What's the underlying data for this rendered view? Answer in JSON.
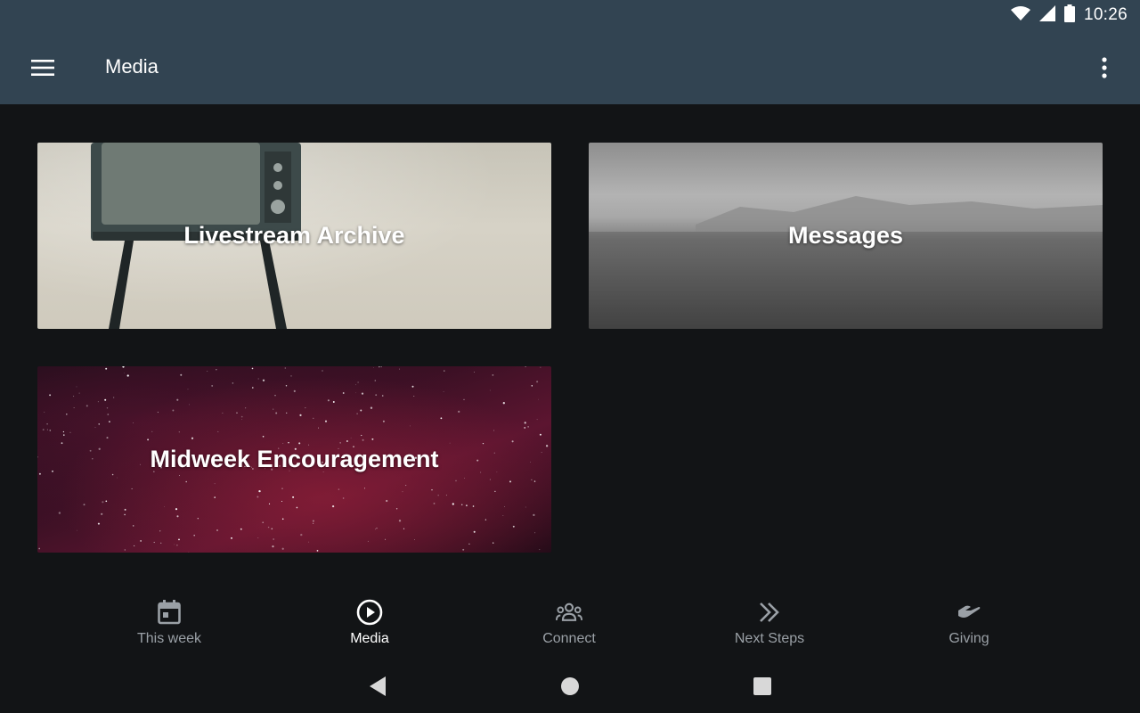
{
  "status_bar": {
    "time": "10:26",
    "icons": [
      "wifi-icon",
      "signal-icon",
      "battery-icon"
    ]
  },
  "app_bar": {
    "title": "Media",
    "menu_icon": "hamburger-menu-icon",
    "overflow_icon": "more-vert-icon"
  },
  "cards": [
    {
      "id": "livestream",
      "label": "Livestream Archive"
    },
    {
      "id": "messages",
      "label": "Messages"
    },
    {
      "id": "midweek",
      "label": "Midweek Encouragement"
    }
  ],
  "bottom_nav": {
    "active": "Media",
    "items": [
      {
        "label": "This week",
        "icon": "calendar-icon"
      },
      {
        "label": "Media",
        "icon": "play-circle-icon"
      },
      {
        "label": "Connect",
        "icon": "group-icon"
      },
      {
        "label": "Next Steps",
        "icon": "double-chevron-icon"
      },
      {
        "label": "Giving",
        "icon": "giving-hand-icon"
      }
    ]
  },
  "system_nav": [
    "back-icon",
    "home-icon",
    "recents-icon"
  ],
  "colors": {
    "app_bar": "#324452",
    "background": "#121416",
    "nav_inactive": "#9aa0a6",
    "nav_active": "#ffffff"
  }
}
